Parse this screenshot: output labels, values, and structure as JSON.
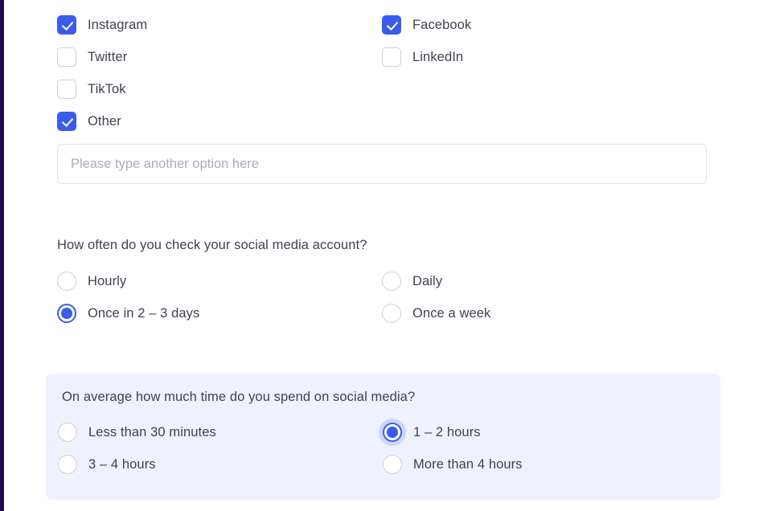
{
  "theme": {
    "accent": "#3a5ced",
    "text": "#3f4250",
    "placeholder": "#a9afbd",
    "panel_background": "#eef1fe",
    "control_border": "#ccd0d9",
    "left_rail": "#1d0b4e"
  },
  "platforms_question": {
    "options": [
      {
        "label": "Instagram",
        "checked": true,
        "icon": "checkbox-checked-icon"
      },
      {
        "label": "Facebook",
        "checked": true,
        "icon": "checkbox-checked-icon"
      },
      {
        "label": "Twitter",
        "checked": false,
        "icon": "checkbox-unchecked-icon"
      },
      {
        "label": "LinkedIn",
        "checked": false,
        "icon": "checkbox-unchecked-icon"
      },
      {
        "label": "TikTok",
        "checked": false,
        "icon": "checkbox-unchecked-icon"
      },
      {
        "label": "Other",
        "checked": true,
        "icon": "checkbox-checked-icon"
      }
    ],
    "other_input": {
      "value": "",
      "placeholder": "Please type another option here"
    }
  },
  "frequency_question": {
    "title": "How often do you check your social media account?",
    "options": [
      {
        "label": "Hourly",
        "selected": false,
        "icon": "radio-unselected-icon"
      },
      {
        "label": "Daily",
        "selected": false,
        "icon": "radio-unselected-icon"
      },
      {
        "label": "Once in 2 – 3 days",
        "selected": true,
        "icon": "radio-selected-icon"
      },
      {
        "label": "Once a week",
        "selected": false,
        "icon": "radio-unselected-icon"
      }
    ]
  },
  "time_question": {
    "title": "On average how much time do you spend on social media?",
    "options": [
      {
        "label": "Less than 30 minutes",
        "selected": false,
        "focused": false,
        "icon": "radio-unselected-icon"
      },
      {
        "label": "1 – 2 hours",
        "selected": true,
        "focused": true,
        "icon": "radio-selected-icon"
      },
      {
        "label": "3 – 4 hours",
        "selected": false,
        "focused": false,
        "icon": "radio-unselected-icon"
      },
      {
        "label": "More than 4 hours",
        "selected": false,
        "focused": false,
        "icon": "radio-unselected-icon"
      }
    ]
  }
}
